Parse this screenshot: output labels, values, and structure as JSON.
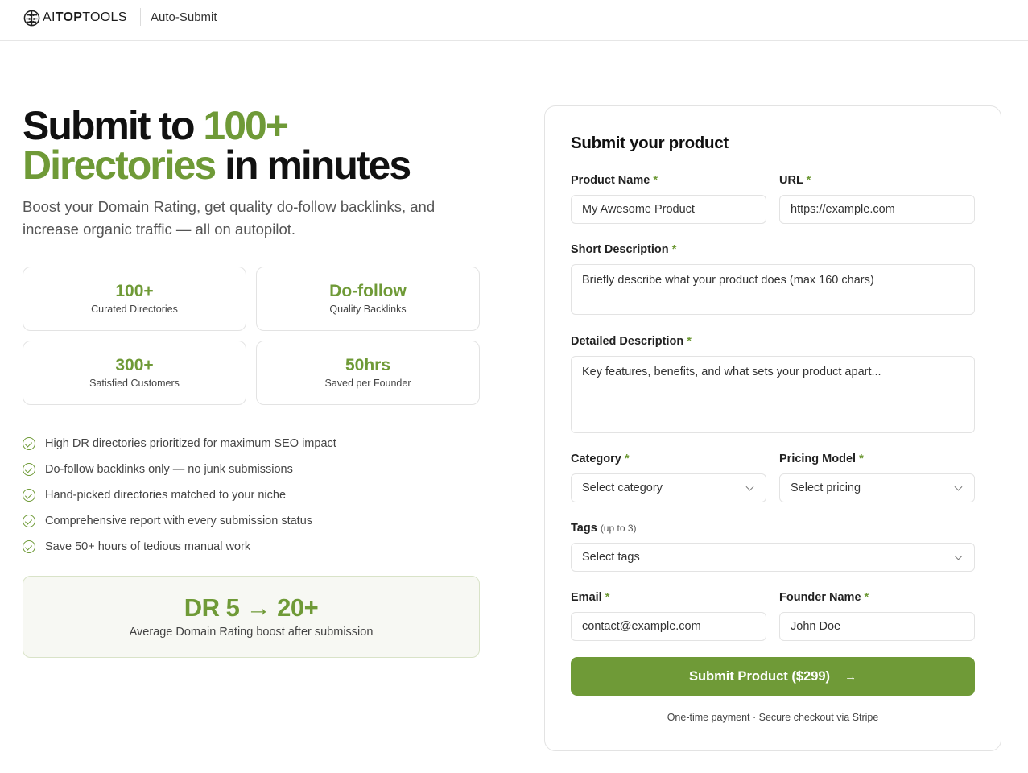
{
  "header": {
    "logo": {
      "part1": "AI",
      "part2": "TOP",
      "part3": "TOOLS"
    },
    "page_label": "Auto-Submit"
  },
  "hero": {
    "title_part1": "Submit to ",
    "title_accent1": "100+",
    "title_accent2": "Directories",
    "title_part2": " in minutes",
    "subtitle": "Boost your Domain Rating, get quality do-follow backlinks, and increase organic traffic — all on autopilot."
  },
  "stats": [
    {
      "value": "100+",
      "label": "Curated Directories"
    },
    {
      "value": "Do-follow",
      "label": "Quality Backlinks"
    },
    {
      "value": "300+",
      "label": "Satisfied Customers"
    },
    {
      "value": "50hrs",
      "label": "Saved per Founder"
    }
  ],
  "features": [
    "High DR directories prioritized for maximum SEO impact",
    "Do-follow backlinks only — no junk submissions",
    "Hand-picked directories matched to your niche",
    "Comprehensive report with every submission status",
    "Save 50+ hours of tedious manual work"
  ],
  "dr_boost": {
    "value": "DR 5 → 20+",
    "label": "Average Domain Rating boost after submission"
  },
  "form": {
    "title": "Submit your product",
    "required_mark": "*",
    "product_name": {
      "label": "Product Name",
      "placeholder": "My Awesome Product"
    },
    "url": {
      "label": "URL",
      "placeholder": "https://example.com"
    },
    "short_description": {
      "label": "Short Description",
      "placeholder": "Briefly describe what your product does (max 160 chars)"
    },
    "detailed_description": {
      "label": "Detailed Description",
      "placeholder": "Key features, benefits, and what sets your product apart..."
    },
    "category": {
      "label": "Category",
      "value": "Select category"
    },
    "pricing_model": {
      "label": "Pricing Model",
      "value": "Select pricing"
    },
    "tags": {
      "label": "Tags",
      "hint": "(up to 3)",
      "value": "Select tags"
    },
    "email": {
      "label": "Email",
      "placeholder": "contact@example.com"
    },
    "founder_name": {
      "label": "Founder Name",
      "placeholder": "John Doe"
    },
    "submit_label": "Submit Product ($299)",
    "submit_arrow": "→",
    "payment_note": "One-time payment · Secure checkout via Stripe"
  },
  "colors": {
    "accent": "#6f9a37",
    "border": "#e3e3e3",
    "dr_background": "#f7f8f3"
  },
  "icons": {
    "logo": "brain-icon",
    "feature": "check-circle-icon",
    "select": "chevron-down-icon",
    "submit": "arrow-right-icon"
  }
}
